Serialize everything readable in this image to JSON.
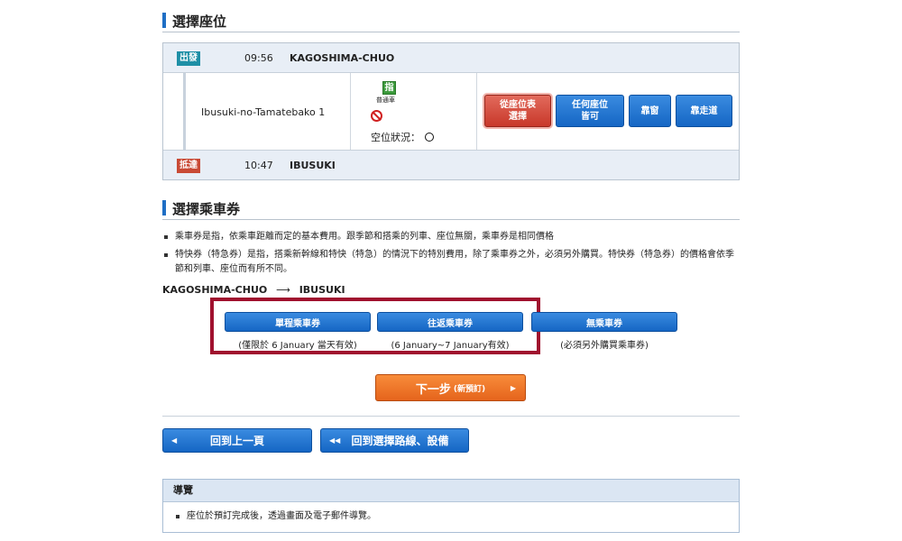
{
  "seat_section": {
    "title": "選擇座位",
    "departure": {
      "badge": "出發",
      "time": "09:56",
      "station": "KAGOSHIMA-CHUO"
    },
    "train": {
      "name": "Ibusuki-no-Tamatebako 1",
      "reserved_icon_char": "指",
      "car_type": "普通車",
      "vacancy_label": "空位狀況："
    },
    "arrival": {
      "badge": "抵達",
      "time": "10:47",
      "station": "IBUSUKI"
    },
    "seat_buttons": [
      "從座位表選擇",
      "任何座位皆可",
      "靠窗",
      "靠走道"
    ]
  },
  "ticket_section": {
    "title": "選擇乘車券",
    "notes": [
      "乘車券是指，依乘車距離而定的基本費用。跟季節和搭乘的列車、座位無關，乘車券是相同價格",
      "特快券（特急券）是指，搭乘新幹線和特快（特急）的情況下的特別費用，除了乘車券之外，必須另外購買。特快券（特急券）的價格會依季節和列車、座位而有所不同。"
    ],
    "route_from": "KAGOSHIMA-CHUO",
    "route_to": "IBUSUKI",
    "options": [
      {
        "label": "單程乘車券",
        "note": "(僅限於 6 January 當天有效)"
      },
      {
        "label": "往返乘車券",
        "note": "(6 January~7 January有效)"
      },
      {
        "label": "無乘車券",
        "note": "(必須另外購買乘車券)"
      }
    ]
  },
  "next_button": {
    "label": "下一步",
    "sub": "(新預訂)"
  },
  "nav": {
    "back_label": "回到上一頁",
    "route_label": "回到選擇路線、設備"
  },
  "guide": {
    "title": "導覽",
    "text": "座位於預訂完成後，透過畫面及電子郵件導覽。"
  },
  "colors": {
    "accent_blue": "#1566c4",
    "selected_red": "#c8382a",
    "next_orange": "#e5641c",
    "highlight": "#a0112e"
  }
}
